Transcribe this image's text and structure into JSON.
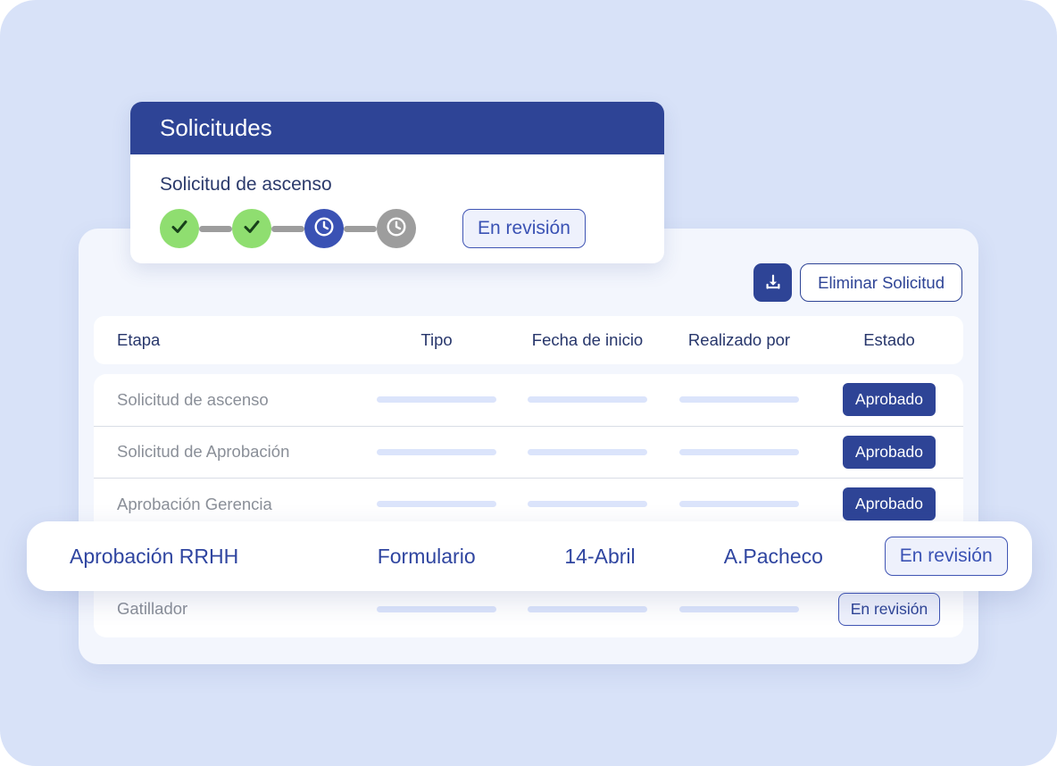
{
  "request_card": {
    "title": "Solicitudes",
    "subtitle": "Solicitud de ascenso",
    "status_label": "En revisión",
    "steps": [
      {
        "state": "done",
        "icon": "check-icon"
      },
      {
        "state": "done",
        "icon": "check-icon"
      },
      {
        "state": "active",
        "icon": "clock-icon"
      },
      {
        "state": "pending",
        "icon": "clock-icon"
      }
    ]
  },
  "toolbar": {
    "download_icon": "download-icon",
    "delete_label": "Eliminar Solicitud"
  },
  "table": {
    "headers": [
      "Etapa",
      "Tipo",
      "Fecha de inicio",
      "Realizado por",
      "Estado"
    ],
    "rows": [
      {
        "etapa": "Solicitud de ascenso",
        "tipo": "",
        "fecha": "",
        "realizado_por": "",
        "estado": "Aprobado",
        "estado_style": "solid"
      },
      {
        "etapa": "Solicitud de Aprobación",
        "tipo": "",
        "fecha": "",
        "realizado_por": "",
        "estado": "Aprobado",
        "estado_style": "solid"
      },
      {
        "etapa": "Aprobación Gerencia",
        "tipo": "",
        "fecha": "",
        "realizado_por": "",
        "estado": "Aprobado",
        "estado_style": "solid"
      },
      {
        "etapa": "Aprobación RRHH",
        "tipo": "",
        "fecha": "",
        "realizado_por": "",
        "estado": "En revisión",
        "estado_style": "outline"
      },
      {
        "etapa": "Gatillador",
        "tipo": "",
        "fecha": "",
        "realizado_por": "",
        "estado": "En revisión",
        "estado_style": "outline"
      }
    ]
  },
  "highlighted_row": {
    "etapa": "Aprobación RRHH",
    "tipo": "Formulario",
    "fecha": "14-Abril",
    "realizado_por": "A.Pacheco",
    "estado": "En revisión"
  },
  "colors": {
    "backdrop": "#d8e2f8",
    "panel": "#f3f6fd",
    "primary": "#2e4496",
    "accent_blue": "#3a52b4",
    "step_done": "#8fde70",
    "step_pending": "#9d9d9d",
    "placeholder_bar": "#dbe4fb",
    "badge_outline_fill": "#eef1fc",
    "muted_text": "#8a8f98"
  }
}
